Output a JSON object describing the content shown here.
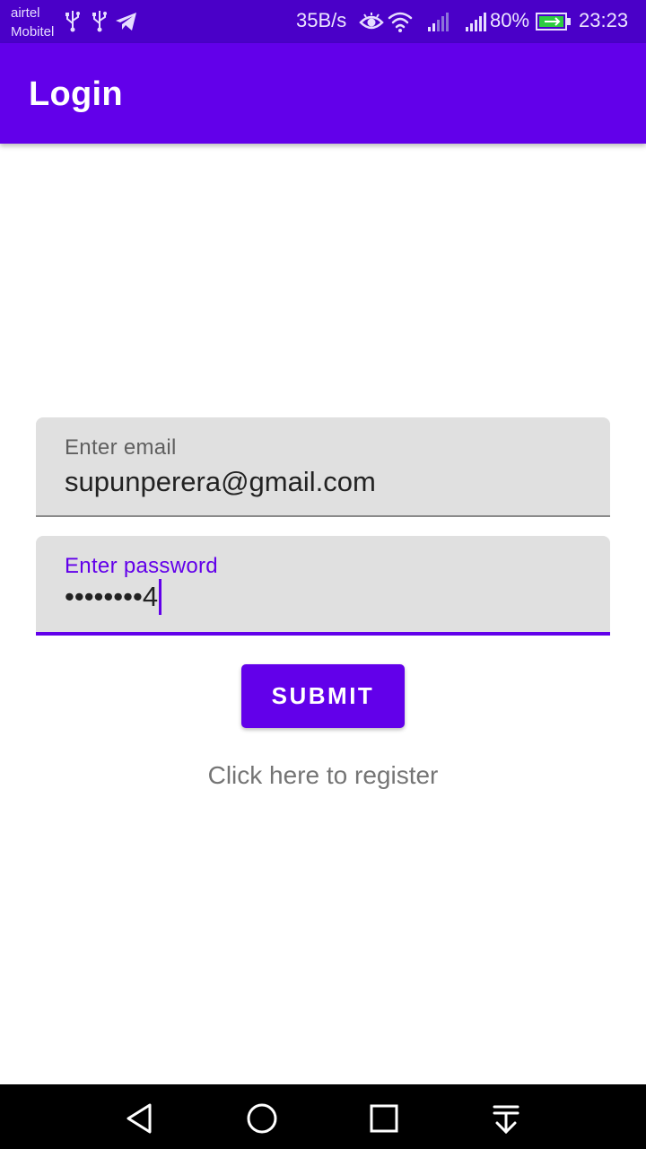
{
  "status_bar": {
    "carrier_1": "airtel",
    "carrier_2": "Mobitel",
    "net_speed": "35B/s",
    "battery": "80%",
    "time": "23:23",
    "icons": [
      "usb-icon",
      "usb-icon",
      "telegram-icon",
      "eye-icon",
      "wifi-icon",
      "signal-icon",
      "signal-icon",
      "battery-charging-icon"
    ]
  },
  "app_bar": {
    "title": "Login"
  },
  "form": {
    "email_label": "Enter email",
    "email_value": "supunperera@gmail.com",
    "password_label": "Enter password",
    "password_masked": "••••••••",
    "password_last_char": "4",
    "submit_label": "SUBMIT",
    "register_link": "Click here to register"
  },
  "nav_bar": {
    "buttons": [
      "back-icon",
      "home-icon",
      "recents-icon",
      "notification-shade-icon"
    ]
  },
  "colors": {
    "status_bar": "#4a00c8",
    "primary": "#6200ea",
    "field_bg": "#e0e0e0",
    "link_text": "#757575"
  }
}
